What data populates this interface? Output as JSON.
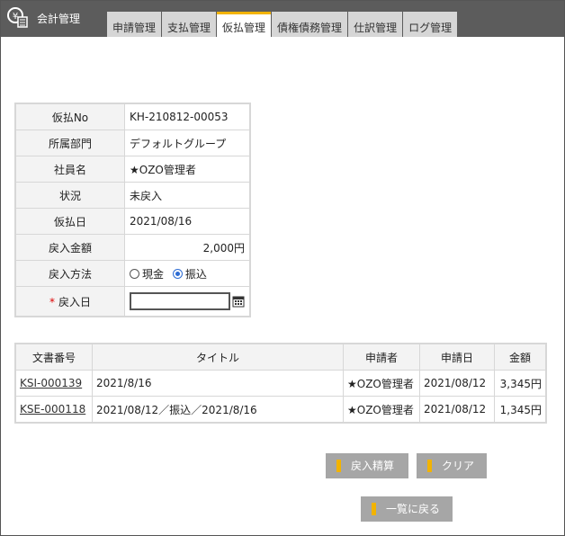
{
  "app": {
    "title": "会計管理",
    "icon": "accounting-icon"
  },
  "tabs": [
    {
      "label": "申請管理"
    },
    {
      "label": "支払管理"
    },
    {
      "label": "仮払管理",
      "active": true
    },
    {
      "label": "債権債務管理"
    },
    {
      "label": "仕訳管理"
    },
    {
      "label": "ログ管理"
    }
  ],
  "detail": {
    "rows": [
      {
        "key": "仮払No",
        "value": "KH-210812-00053"
      },
      {
        "key": "所属部門",
        "value": "デフォルトグループ"
      },
      {
        "key": "社員名",
        "value": "★OZO管理者"
      },
      {
        "key": "状況",
        "value": "未戻入"
      },
      {
        "key": "仮払日",
        "value": "2021/08/16"
      },
      {
        "key": "戻入金額",
        "value": "2,000円"
      }
    ],
    "method": {
      "key": "戻入方法",
      "options": [
        "現金",
        "振込"
      ],
      "selected": "振込"
    },
    "return_date": {
      "required_mark": "*",
      "key": "戻入日",
      "value": ""
    }
  },
  "documents": {
    "headers": [
      "文書番号",
      "タイトル",
      "申請者",
      "申請日",
      "金額"
    ],
    "rows": [
      {
        "doc_no": "KSI-000139",
        "title": "2021/8/16",
        "applicant": "★OZO管理者",
        "date": "2021/08/12",
        "amount": "3,345円"
      },
      {
        "doc_no": "KSE-000118",
        "title": "2021/08/12／振込／2021/8/16",
        "applicant": "★OZO管理者",
        "date": "2021/08/12",
        "amount": "1,345円"
      }
    ]
  },
  "buttons": {
    "settle": "戻入精算",
    "clear": "クリア",
    "back": "一覧に戻る"
  },
  "colors": {
    "accent": "#f2b300",
    "header": "#5c5c5c",
    "button": "#a6a6a6"
  }
}
